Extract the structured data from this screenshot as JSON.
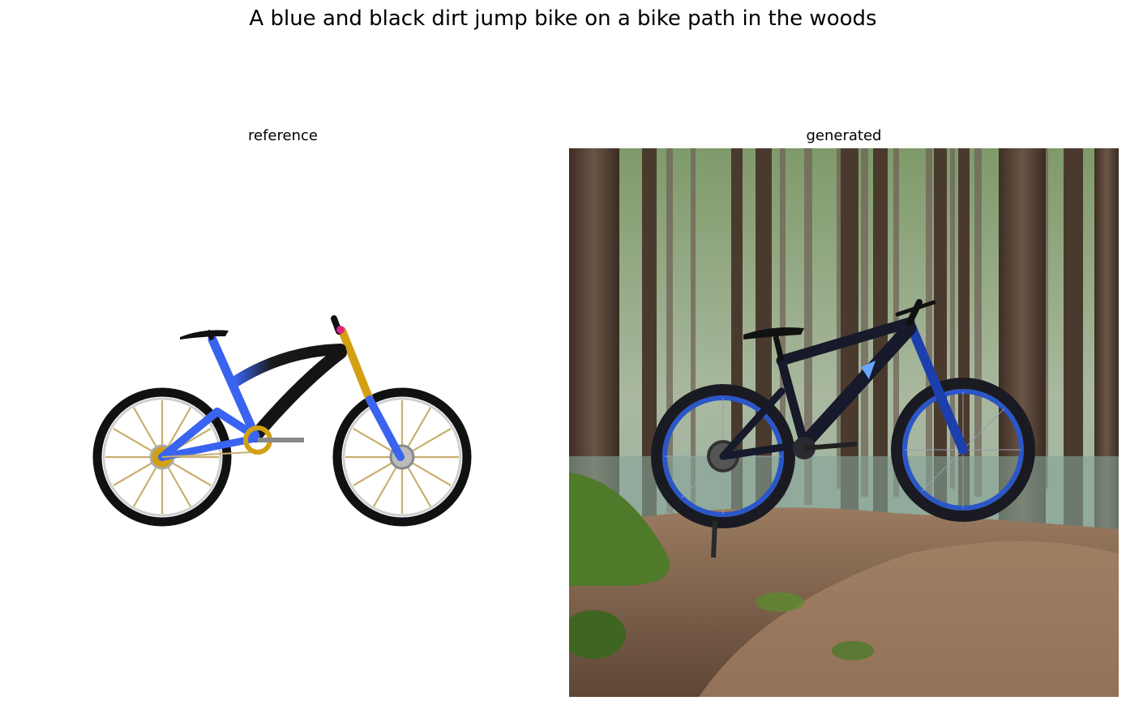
{
  "figure": {
    "title": "A blue and black dirt jump bike on a bike path in the woods"
  },
  "panels": [
    {
      "title": "reference",
      "image": "cartoon blue and black mountain bike with gold forks on white background"
    },
    {
      "title": "generated",
      "image": "photo of a black and blue full-suspension mountain bike on a dirt trail in a forest"
    }
  ],
  "colors": {
    "frame_blue": "#3a63f0",
    "frame_black": "#141414",
    "fork_gold": "#d2a010",
    "rim_blue": "#2a56c8",
    "trail_brown": "#8e6b52",
    "moss_green": "#4e7a2a"
  }
}
